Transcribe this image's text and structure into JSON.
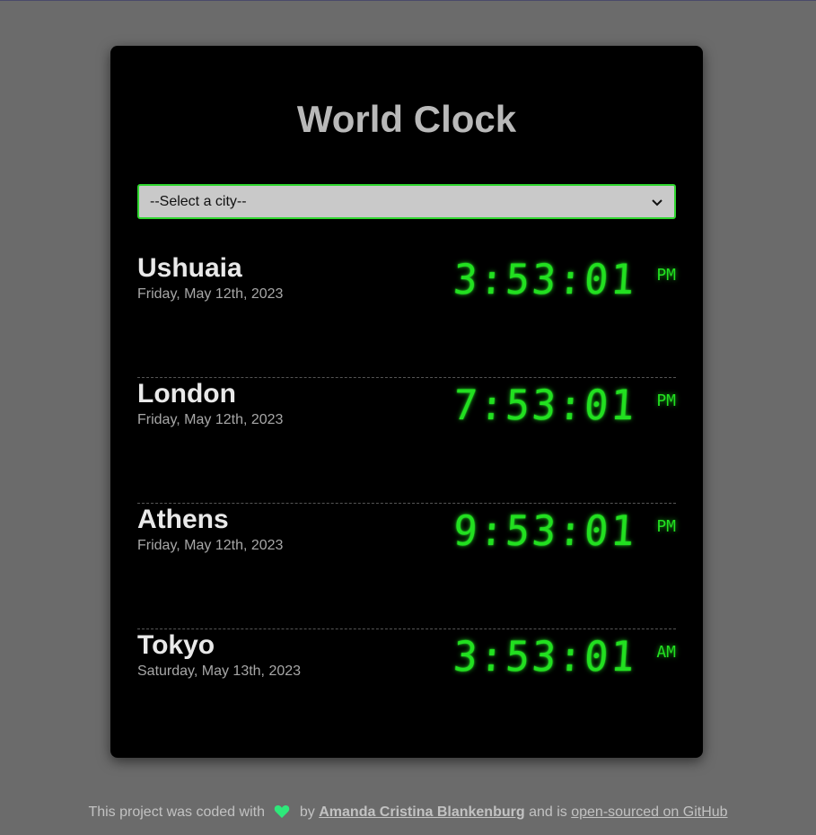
{
  "title": "World Clock",
  "select": {
    "placeholder": "--Select a city--"
  },
  "cities": [
    {
      "name": "Ushuaia",
      "date": "Friday, May 12th, 2023",
      "time": "3:53:01",
      "ampm": "PM"
    },
    {
      "name": "London",
      "date": "Friday, May 12th, 2023",
      "time": "7:53:01",
      "ampm": "PM"
    },
    {
      "name": "Athens",
      "date": "Friday, May 12th, 2023",
      "time": "9:53:01",
      "ampm": "PM"
    },
    {
      "name": "Tokyo",
      "date": "Saturday, May 13th, 2023",
      "time": "3:53:01",
      "ampm": "AM"
    }
  ],
  "footer": {
    "text_before": "This project was coded with",
    "by": "by",
    "author": "Amanda Cristina Blankenburg",
    "middle": "and is",
    "repo_link": "open-sourced on GitHub",
    "heart_icon": "heart-icon"
  },
  "colors": {
    "background": "#6b6b6b",
    "card": "#000000",
    "accent_green": "#22e020",
    "heart": "#2ee87a"
  }
}
